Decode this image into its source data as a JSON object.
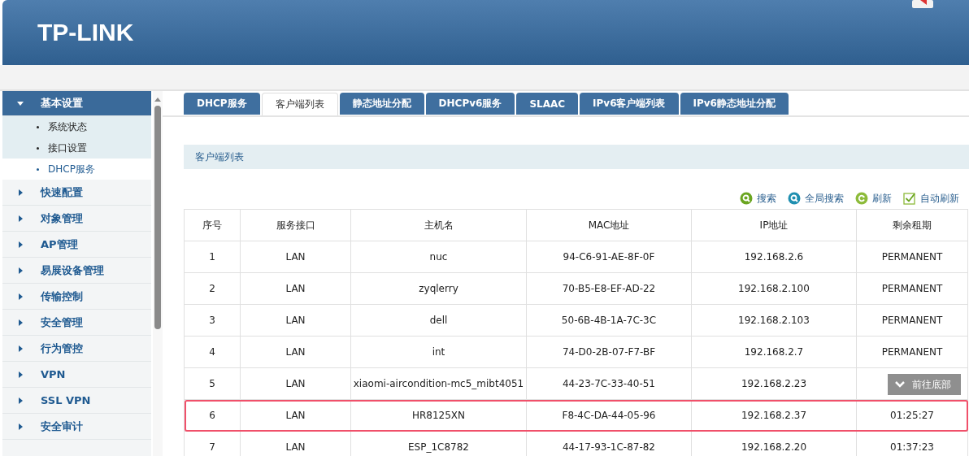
{
  "header": {
    "logo": "TP-LINK"
  },
  "sidebar": {
    "items": [
      {
        "label": "基本设置",
        "expanded": true,
        "children": [
          {
            "label": "系统状态",
            "selected": false
          },
          {
            "label": "接口设置",
            "selected": false
          },
          {
            "label": "DHCP服务",
            "selected": true
          }
        ]
      },
      {
        "label": "快速配置",
        "expanded": false
      },
      {
        "label": "对象管理",
        "expanded": false
      },
      {
        "label": "AP管理",
        "expanded": false
      },
      {
        "label": "易展设备管理",
        "expanded": false
      },
      {
        "label": "传输控制",
        "expanded": false
      },
      {
        "label": "安全管理",
        "expanded": false
      },
      {
        "label": "行为管控",
        "expanded": false
      },
      {
        "label": "VPN",
        "expanded": false
      },
      {
        "label": "SSL VPN",
        "expanded": false
      },
      {
        "label": "安全审计",
        "expanded": false
      }
    ]
  },
  "tabs": [
    {
      "label": "DHCP服务",
      "selected": false
    },
    {
      "label": "客户端列表",
      "selected": true
    },
    {
      "label": "静态地址分配",
      "selected": false
    },
    {
      "label": "DHCPv6服务",
      "selected": false
    },
    {
      "label": "SLAAC",
      "selected": false
    },
    {
      "label": "IPv6客户端列表",
      "selected": false
    },
    {
      "label": "IPv6静态地址分配",
      "selected": false
    }
  ],
  "section_title": "客户端列表",
  "toolbar": [
    {
      "kind": "search",
      "label": "搜索"
    },
    {
      "kind": "global-search",
      "label": "全局搜索"
    },
    {
      "kind": "refresh",
      "label": "刷新"
    },
    {
      "kind": "checkbox",
      "label": "自动刷新",
      "checked": true
    }
  ],
  "table": {
    "columns": [
      "序号",
      "服务接口",
      "主机名",
      "MAC地址",
      "IP地址",
      "剩余租期"
    ],
    "rows": [
      {
        "cells": [
          "1",
          "LAN",
          "nuc",
          "94-C6-91-AE-8F-0F",
          "192.168.2.6",
          "PERMANENT"
        ],
        "highlighted": false
      },
      {
        "cells": [
          "2",
          "LAN",
          "zyqlerry",
          "70-B5-E8-EF-AD-22",
          "192.168.2.100",
          "PERMANENT"
        ],
        "highlighted": false
      },
      {
        "cells": [
          "3",
          "LAN",
          "dell",
          "50-6B-4B-1A-7C-3C",
          "192.168.2.103",
          "PERMANENT"
        ],
        "highlighted": false
      },
      {
        "cells": [
          "4",
          "LAN",
          "int",
          "74-D0-2B-07-F7-BF",
          "192.168.2.7",
          "PERMANENT"
        ],
        "highlighted": false
      },
      {
        "cells": [
          "5",
          "LAN",
          "xiaomi-aircondition-mc5_mibt4051",
          "44-23-7C-33-40-51",
          "192.168.2.23"
        ],
        "highlighted": false
      },
      {
        "cells": [
          "6",
          "LAN",
          "HR8125XN",
          "F8-4C-DA-44-05-96",
          "192.168.2.37",
          "01:25:27"
        ],
        "highlighted": true
      },
      {
        "cells": [
          "7",
          "LAN",
          "ESP_1C8782",
          "44-17-93-1C-87-82",
          "192.168.2.20",
          "01:37:23"
        ],
        "highlighted": false
      }
    ]
  },
  "go_bottom_button": {
    "label": "前往底部"
  }
}
